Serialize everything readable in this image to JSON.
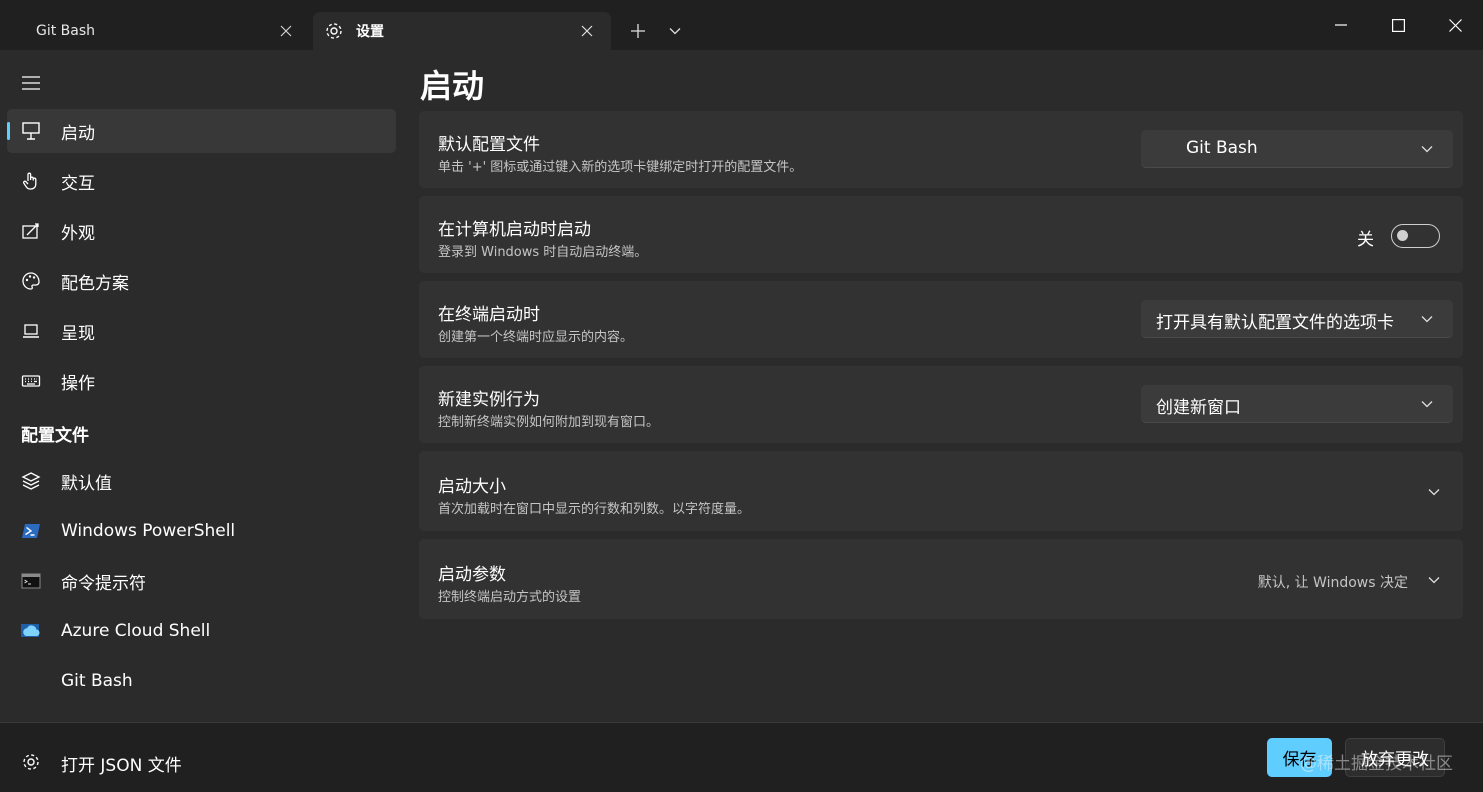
{
  "tabs": [
    {
      "title": "Git Bash",
      "active": false
    },
    {
      "title": "设置",
      "active": true
    }
  ],
  "tab_icons": {
    "settings": "gear-icon",
    "close": "close-icon",
    "new_tab": "plus-icon",
    "dropdown": "chevron-down-icon"
  },
  "window_controls": [
    "minimize",
    "maximize",
    "close"
  ],
  "colors": {
    "accent": "#60cdff",
    "background": "#202020",
    "panel": "#2b2b2b",
    "card": "#323232"
  },
  "sidebar": {
    "items": [
      {
        "label": "启动",
        "icon": "startup-icon",
        "selected": true
      },
      {
        "label": "交互",
        "icon": "hand-pointer-icon"
      },
      {
        "label": "外观",
        "icon": "appearance-icon"
      },
      {
        "label": "配色方案",
        "icon": "palette-icon"
      },
      {
        "label": "呈现",
        "icon": "laptop-icon"
      },
      {
        "label": "操作",
        "icon": "keyboard-icon"
      }
    ],
    "profiles_header": "配置文件",
    "profiles": [
      {
        "label": "默认值",
        "icon": "layers-icon"
      },
      {
        "label": "Windows PowerShell",
        "icon": "powershell-icon"
      },
      {
        "label": "命令提示符",
        "icon": "cmd-icon"
      },
      {
        "label": "Azure Cloud Shell",
        "icon": "azure-cloud-icon"
      },
      {
        "label": "Git Bash",
        "icon": ""
      }
    ]
  },
  "page": {
    "title": "启动",
    "settings": [
      {
        "title": "默认配置文件",
        "description": "单击 '+' 图标或通过键入新的选项卡键绑定时打开的配置文件。",
        "control": "dropdown",
        "value": "Git Bash"
      },
      {
        "title": "在计算机启动时启动",
        "description": "登录到 Windows 时自动启动终端。",
        "control": "toggle",
        "value": "关",
        "on": false
      },
      {
        "title": "在终端启动时",
        "description": "创建第一个终端时应显示的内容。",
        "control": "dropdown",
        "value": "打开具有默认配置文件的选项卡"
      },
      {
        "title": "新建实例行为",
        "description": "控制新终端实例如何附加到现有窗口。",
        "control": "dropdown",
        "value": "创建新窗口"
      },
      {
        "title": "启动大小",
        "description": "首次加载时在窗口中显示的行数和列数。以字符度量。",
        "control": "expander"
      },
      {
        "title": "启动参数",
        "description": "控制终端启动方式的设置",
        "control": "expander",
        "value": "默认, 让 Windows 决定"
      }
    ]
  },
  "footer": {
    "open_json": "打开 JSON 文件",
    "save": "保存",
    "discard": "放弃更改",
    "watermark": "@稀土掘金技术社区"
  }
}
